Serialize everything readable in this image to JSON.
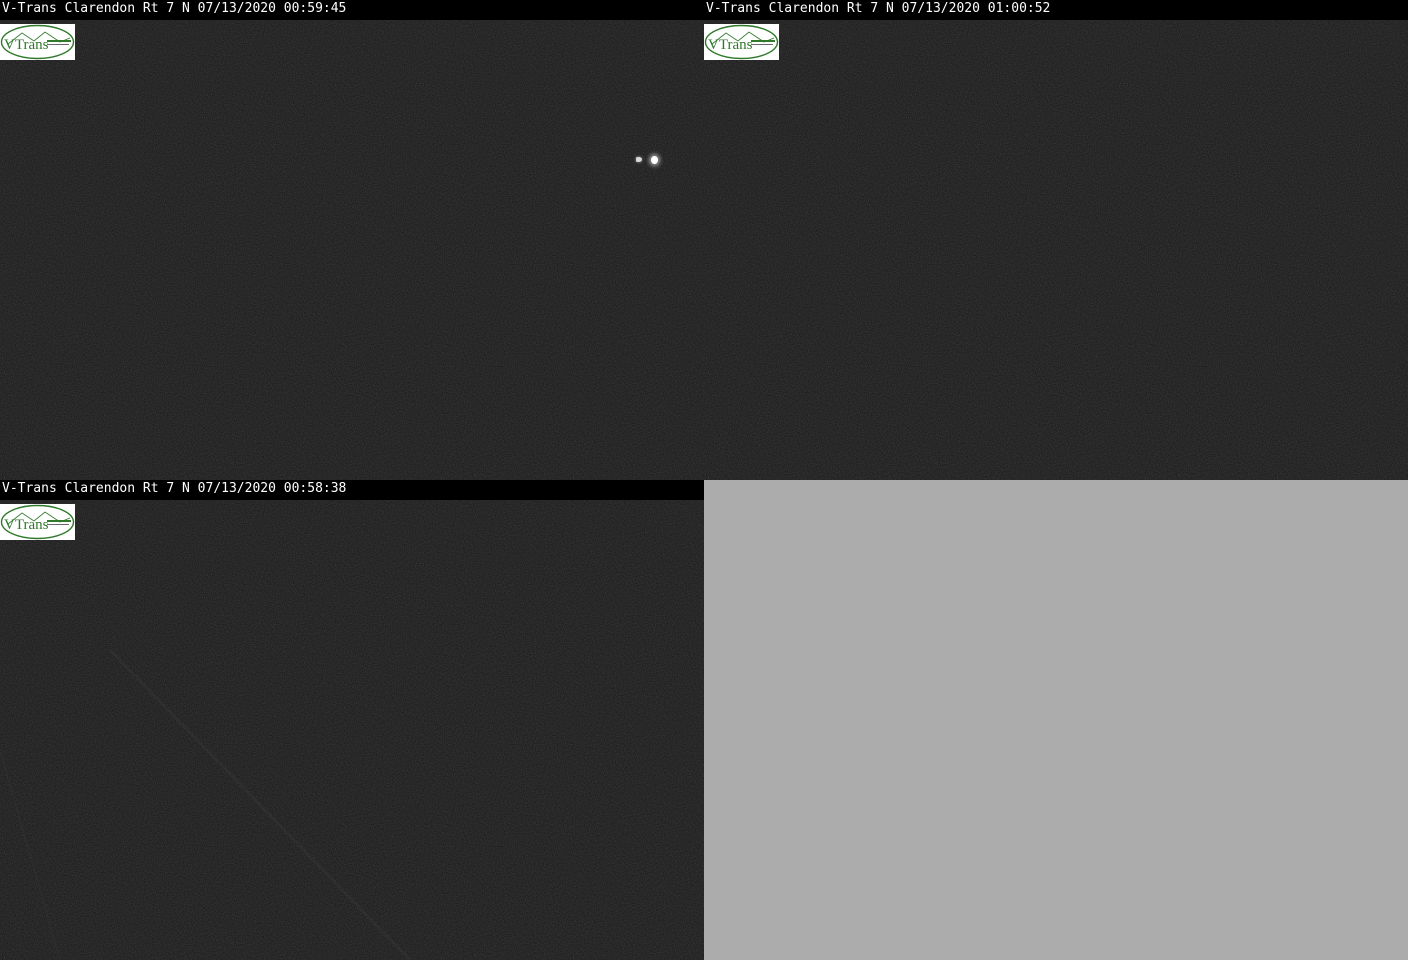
{
  "panels": [
    {
      "caption": "V-Trans Clarendon Rt 7 N 07/13/2020 00:59:45",
      "logo_text": "VTrans"
    },
    {
      "caption": "V-Trans Clarendon Rt 7 N 07/13/2020 01:00:52",
      "logo_text": "VTrans"
    },
    {
      "caption": "V-Trans Clarendon Rt 7 N 07/13/2020 00:58:38",
      "logo_text": "VTrans"
    }
  ],
  "colors": {
    "feed_background": "#131313",
    "empty_panel": "#acacac",
    "logo_green": "#2f7a2a",
    "caption_text": "#ffffff"
  }
}
